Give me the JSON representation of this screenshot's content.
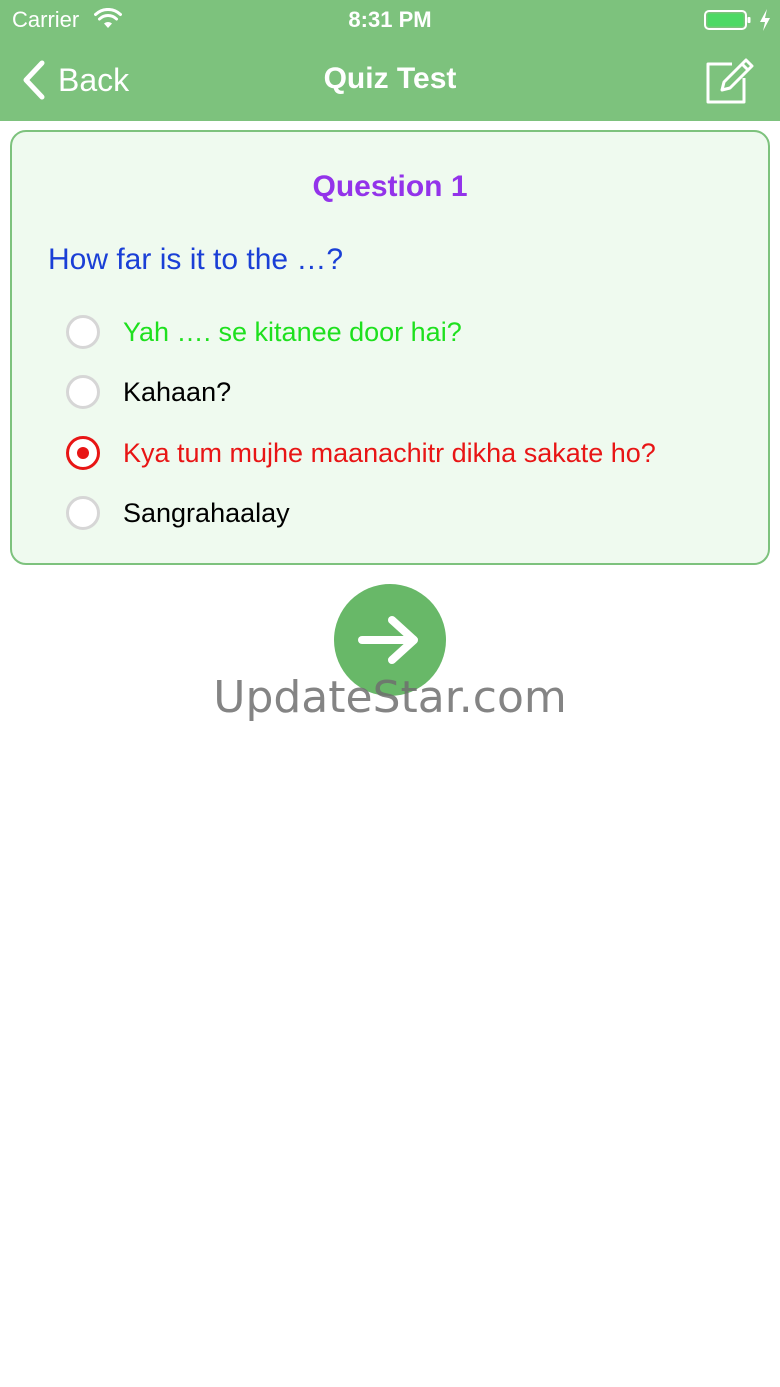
{
  "status_bar": {
    "carrier": "Carrier",
    "time": "8:31 PM"
  },
  "nav": {
    "back_label": "Back",
    "title": "Quiz Test"
  },
  "quiz": {
    "question_number": "Question 1",
    "question_text": "How far is it to the …?",
    "options": [
      {
        "label": "Yah …. se kitanee door hai?",
        "state": "correct"
      },
      {
        "label": "Kahaan?",
        "state": "normal"
      },
      {
        "label": "Kya tum mujhe maanachitr dikha sakate ho?",
        "state": "wrong-selected"
      },
      {
        "label": "Sangrahaalay",
        "state": "normal"
      }
    ]
  },
  "watermark": "UpdateStar.com",
  "colors": {
    "header_green": "#7dc27d",
    "card_background": "#effaef",
    "question_number": "#9333ea",
    "question_text": "#1a3fd6",
    "correct_answer": "#1ee01e",
    "wrong_answer": "#e81515",
    "next_button": "#68b868"
  }
}
